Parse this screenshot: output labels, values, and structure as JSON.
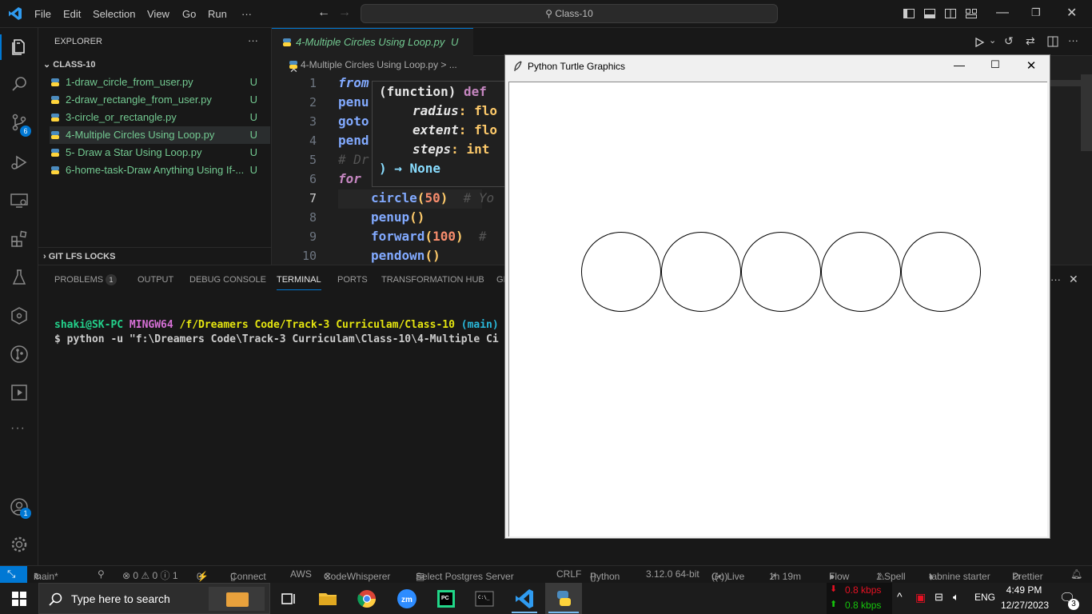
{
  "titlebar": {
    "menus": [
      "File",
      "Edit",
      "Selection",
      "View",
      "Go",
      "Run",
      "···"
    ],
    "search_text": "Class-10"
  },
  "activity": {
    "scm_badge": "6",
    "accounts_badge": "1"
  },
  "explorer": {
    "header": "EXPLORER",
    "more": "···",
    "folder": "CLASS-10",
    "files": [
      {
        "name": "1-draw_circle_from_user.py",
        "status": "U"
      },
      {
        "name": "2-draw_rectangle_from_user.py",
        "status": "U"
      },
      {
        "name": "3-circle_or_rectangle.py",
        "status": "U"
      },
      {
        "name": "4-Multiple Circles Using Loop.py",
        "status": "U"
      },
      {
        "name": "5- Draw a Star Using Loop.py",
        "status": "U"
      },
      {
        "name": "6-home-task-Draw Anything Using If-...",
        "status": "U"
      }
    ],
    "git_lfs": "GIT LFS LOCKS"
  },
  "editor": {
    "tab_label": "4-Multiple Circles Using Loop.py",
    "tab_status": "U",
    "breadcrumb": "4-Multiple Circles Using Loop.py > ...",
    "line_numbers": [
      "1",
      "2",
      "3",
      "4",
      "5",
      "6",
      "7",
      "8",
      "9",
      "10"
    ],
    "lines": {
      "l1": "from",
      "l2": "penu",
      "l3": "goto",
      "l4": "pend",
      "l5": "# Dr",
      "l6": "for",
      "l7a": "circle",
      "l7b": "(",
      "l7c": "50",
      "l7d": ")",
      "l7e": "  # Yo",
      "l8a": "penup",
      "l8b": "()",
      "l9a": "forward",
      "l9b": "(",
      "l9c": "100",
      "l9d": ")",
      "l9e": "  #",
      "l10a": "pendown",
      "l10b": "()"
    },
    "hover": {
      "line1a": "(function)",
      "line1b": " def",
      "line2a": "radius",
      "line2b": ": flo",
      "line3a": "extent",
      "line3b": ": flo",
      "line4a": "steps",
      "line4b": ": int",
      "line5": ") → None"
    }
  },
  "panel": {
    "tabs": [
      "PROBLEMS",
      "OUTPUT",
      "DEBUG CONSOLE",
      "TERMINAL",
      "PORTS",
      "TRANSFORMATION HUB",
      "GI"
    ],
    "problems_count": "1",
    "terminal": {
      "user": "shaki@SK-PC",
      "shell": "MINGW64",
      "path": "/f/Dreamers Code/Track-3 Curriculam/Class-10",
      "branch": "(main)",
      "command": "$ python -u \"f:\\Dreamers Code\\Track-3 Curriculam\\Class-10\\4-Multiple Ci"
    }
  },
  "statusbar": {
    "branch": "main*",
    "errors": "⊗ 0 ⚠ 0 ⓘ 1",
    "ports": "0",
    "connect": "Connect",
    "aws": "AWS",
    "codewhisperer": "CodeWhisperer",
    "postgres": "Select Postgres Server",
    "eol": "CRLF",
    "lang": "Python",
    "version": "3.12.0 64-bit",
    "golive": "Go Live",
    "time": "1h 19m",
    "flow": "Flow",
    "spell": "1 Spell",
    "tabnine": "tabnine starter",
    "prettier": "Prettier"
  },
  "turtle_window": {
    "title": "Python Turtle Graphics",
    "circles_count": 5
  },
  "taskbar": {
    "search": "Type here to search",
    "net_down": "0.8 kbps",
    "net_up": "0.8 kbps",
    "lang": "ENG",
    "time": "4:49 PM",
    "date": "12/27/2023",
    "notif": "3"
  },
  "colors": {
    "accent": "#0078d4",
    "untracked": "#73c991",
    "keyword": "#c586c0",
    "function": "#82aaff",
    "number": "#f78c6c"
  }
}
